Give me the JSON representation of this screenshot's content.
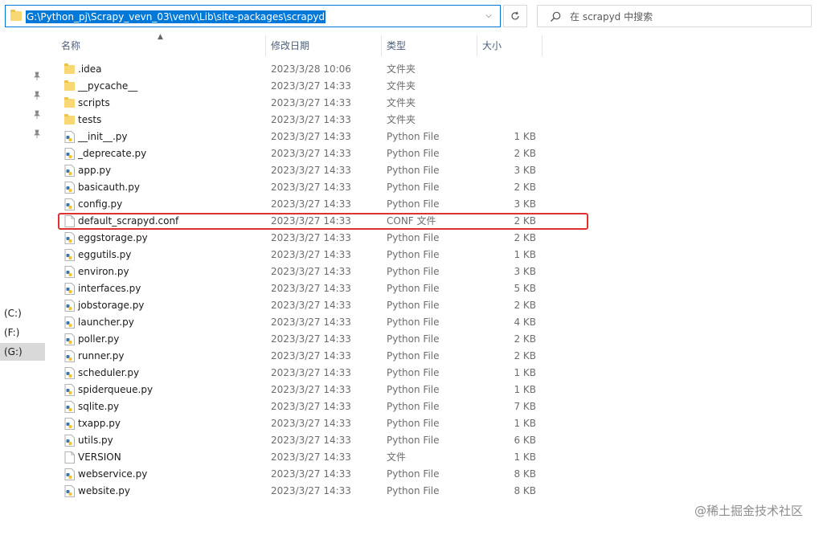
{
  "address": {
    "path": "G:\\Python_pj\\Scrapy_vevn_03\\venv\\Lib\\site-packages\\scrapyd"
  },
  "search": {
    "placeholder": "在 scrapyd 中搜索"
  },
  "icons": {
    "refresh": "refresh-icon",
    "search": "search-icon",
    "folder": "folder-icon",
    "python": "python-file-icon",
    "file": "file-icon",
    "pin": "pin-icon"
  },
  "header": {
    "name": "名称",
    "date": "修改日期",
    "type": "类型",
    "size": "大小"
  },
  "drives": [
    "(C:)",
    "(F:)",
    "(G:)"
  ],
  "rows": [
    {
      "name": ".idea",
      "date": "2023/3/28 10:06",
      "type": "文件夹",
      "size": "",
      "kind": "folder"
    },
    {
      "name": "__pycache__",
      "date": "2023/3/27 14:33",
      "type": "文件夹",
      "size": "",
      "kind": "folder"
    },
    {
      "name": "scripts",
      "date": "2023/3/27 14:33",
      "type": "文件夹",
      "size": "",
      "kind": "folder"
    },
    {
      "name": "tests",
      "date": "2023/3/27 14:33",
      "type": "文件夹",
      "size": "",
      "kind": "folder"
    },
    {
      "name": "__init__.py",
      "date": "2023/3/27 14:33",
      "type": "Python File",
      "size": "1 KB",
      "kind": "py"
    },
    {
      "name": "_deprecate.py",
      "date": "2023/3/27 14:33",
      "type": "Python File",
      "size": "2 KB",
      "kind": "py"
    },
    {
      "name": "app.py",
      "date": "2023/3/27 14:33",
      "type": "Python File",
      "size": "3 KB",
      "kind": "py"
    },
    {
      "name": "basicauth.py",
      "date": "2023/3/27 14:33",
      "type": "Python File",
      "size": "2 KB",
      "kind": "py"
    },
    {
      "name": "config.py",
      "date": "2023/3/27 14:33",
      "type": "Python File",
      "size": "3 KB",
      "kind": "py"
    },
    {
      "name": "default_scrapyd.conf",
      "date": "2023/3/27 14:33",
      "type": "CONF 文件",
      "size": "2 KB",
      "kind": "file"
    },
    {
      "name": "eggstorage.py",
      "date": "2023/3/27 14:33",
      "type": "Python File",
      "size": "2 KB",
      "kind": "py"
    },
    {
      "name": "eggutils.py",
      "date": "2023/3/27 14:33",
      "type": "Python File",
      "size": "1 KB",
      "kind": "py"
    },
    {
      "name": "environ.py",
      "date": "2023/3/27 14:33",
      "type": "Python File",
      "size": "3 KB",
      "kind": "py"
    },
    {
      "name": "interfaces.py",
      "date": "2023/3/27 14:33",
      "type": "Python File",
      "size": "5 KB",
      "kind": "py"
    },
    {
      "name": "jobstorage.py",
      "date": "2023/3/27 14:33",
      "type": "Python File",
      "size": "2 KB",
      "kind": "py"
    },
    {
      "name": "launcher.py",
      "date": "2023/3/27 14:33",
      "type": "Python File",
      "size": "4 KB",
      "kind": "py"
    },
    {
      "name": "poller.py",
      "date": "2023/3/27 14:33",
      "type": "Python File",
      "size": "2 KB",
      "kind": "py"
    },
    {
      "name": "runner.py",
      "date": "2023/3/27 14:33",
      "type": "Python File",
      "size": "2 KB",
      "kind": "py"
    },
    {
      "name": "scheduler.py",
      "date": "2023/3/27 14:33",
      "type": "Python File",
      "size": "1 KB",
      "kind": "py"
    },
    {
      "name": "spiderqueue.py",
      "date": "2023/3/27 14:33",
      "type": "Python File",
      "size": "1 KB",
      "kind": "py"
    },
    {
      "name": "sqlite.py",
      "date": "2023/3/27 14:33",
      "type": "Python File",
      "size": "7 KB",
      "kind": "py"
    },
    {
      "name": "txapp.py",
      "date": "2023/3/27 14:33",
      "type": "Python File",
      "size": "1 KB",
      "kind": "py"
    },
    {
      "name": "utils.py",
      "date": "2023/3/27 14:33",
      "type": "Python File",
      "size": "6 KB",
      "kind": "py"
    },
    {
      "name": "VERSION",
      "date": "2023/3/27 14:33",
      "type": "文件",
      "size": "1 KB",
      "kind": "file"
    },
    {
      "name": "webservice.py",
      "date": "2023/3/27 14:33",
      "type": "Python File",
      "size": "8 KB",
      "kind": "py"
    },
    {
      "name": "website.py",
      "date": "2023/3/27 14:33",
      "type": "Python File",
      "size": "8 KB",
      "kind": "py"
    }
  ],
  "highlight": {
    "row": "default_scrapyd.conf",
    "color": "#e03131"
  },
  "watermark": "@稀土掘金技术社区"
}
